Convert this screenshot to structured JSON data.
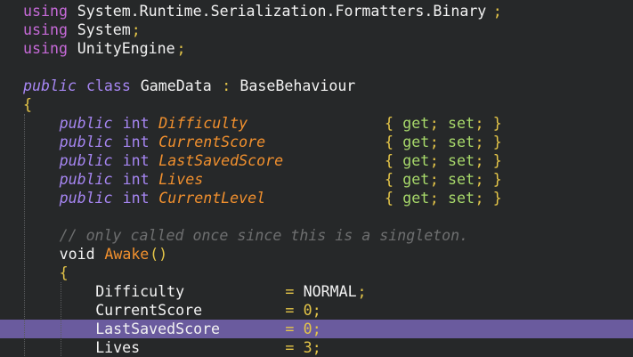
{
  "editor": {
    "lines": [
      {
        "segments": [
          {
            "t": "using",
            "k": "kw-using"
          },
          {
            "t": " System.Runtime.Serialization.Formatters.Binary",
            "k": "plain"
          },
          {
            "t": ";",
            "k": "punct"
          }
        ]
      },
      {
        "segments": [
          {
            "t": "using",
            "k": "kw-using"
          },
          {
            "t": " System",
            "k": "plain"
          },
          {
            "t": ";",
            "k": "punct"
          }
        ]
      },
      {
        "segments": [
          {
            "t": "using",
            "k": "kw-using"
          },
          {
            "t": " UnityEngine",
            "k": "plain"
          },
          {
            "t": ";",
            "k": "punct"
          }
        ]
      },
      {
        "segments": []
      },
      {
        "segments": [
          {
            "t": "public",
            "k": "kw-public"
          },
          {
            "t": " class",
            "k": "kw-class"
          },
          {
            "t": " GameData ",
            "k": "plain"
          },
          {
            "t": ":",
            "k": "op"
          },
          {
            "t": " BaseBehaviour",
            "k": "plain"
          }
        ]
      },
      {
        "segments": [
          {
            "t": "{",
            "k": "punct"
          }
        ]
      },
      {
        "segments": [
          {
            "t": "public",
            "k": "kw-public",
            "c": 4
          },
          {
            "t": "int",
            "k": "type-int",
            "c": 11
          },
          {
            "t": "Difficulty",
            "k": "prop",
            "c": 15
          },
          {
            "t": "{",
            "k": "punct",
            "c": 40
          },
          {
            "t": "get",
            "k": "acc",
            "c": 42
          },
          {
            "t": ";",
            "k": "punct",
            "c": 45
          },
          {
            "t": "set",
            "k": "acc",
            "c": 47
          },
          {
            "t": ";",
            "k": "punct",
            "c": 50
          },
          {
            "t": "}",
            "k": "punct",
            "c": 52
          }
        ]
      },
      {
        "segments": [
          {
            "t": "public",
            "k": "kw-public",
            "c": 4
          },
          {
            "t": "int",
            "k": "type-int",
            "c": 11
          },
          {
            "t": "CurrentScore",
            "k": "prop",
            "c": 15
          },
          {
            "t": "{",
            "k": "punct",
            "c": 40
          },
          {
            "t": "get",
            "k": "acc",
            "c": 42
          },
          {
            "t": ";",
            "k": "punct",
            "c": 45
          },
          {
            "t": "set",
            "k": "acc",
            "c": 47
          },
          {
            "t": ";",
            "k": "punct",
            "c": 50
          },
          {
            "t": "}",
            "k": "punct",
            "c": 52
          }
        ]
      },
      {
        "segments": [
          {
            "t": "public",
            "k": "kw-public",
            "c": 4
          },
          {
            "t": "int",
            "k": "type-int",
            "c": 11
          },
          {
            "t": "LastSavedScore",
            "k": "prop",
            "c": 15
          },
          {
            "t": "{",
            "k": "punct",
            "c": 40
          },
          {
            "t": "get",
            "k": "acc",
            "c": 42
          },
          {
            "t": ";",
            "k": "punct",
            "c": 45
          },
          {
            "t": "set",
            "k": "acc",
            "c": 47
          },
          {
            "t": ";",
            "k": "punct",
            "c": 50
          },
          {
            "t": "}",
            "k": "punct",
            "c": 52
          }
        ]
      },
      {
        "segments": [
          {
            "t": "public",
            "k": "kw-public",
            "c": 4
          },
          {
            "t": "int",
            "k": "type-int",
            "c": 11
          },
          {
            "t": "Lives",
            "k": "prop",
            "c": 15
          },
          {
            "t": "{",
            "k": "punct",
            "c": 40
          },
          {
            "t": "get",
            "k": "acc",
            "c": 42
          },
          {
            "t": ";",
            "k": "punct",
            "c": 45
          },
          {
            "t": "set",
            "k": "acc",
            "c": 47
          },
          {
            "t": ";",
            "k": "punct",
            "c": 50
          },
          {
            "t": "}",
            "k": "punct",
            "c": 52
          }
        ]
      },
      {
        "segments": [
          {
            "t": "public",
            "k": "kw-public",
            "c": 4
          },
          {
            "t": "int",
            "k": "type-int",
            "c": 11
          },
          {
            "t": "CurrentLevel",
            "k": "prop",
            "c": 15
          },
          {
            "t": "{",
            "k": "punct",
            "c": 40
          },
          {
            "t": "get",
            "k": "acc",
            "c": 42
          },
          {
            "t": ";",
            "k": "punct",
            "c": 45
          },
          {
            "t": "set",
            "k": "acc",
            "c": 47
          },
          {
            "t": ";",
            "k": "punct",
            "c": 50
          },
          {
            "t": "}",
            "k": "punct",
            "c": 52
          }
        ]
      },
      {
        "segments": []
      },
      {
        "segments": [
          {
            "t": "// only called once since this is a singleton.",
            "k": "comment",
            "c": 4
          }
        ]
      },
      {
        "segments": [
          {
            "t": "void",
            "k": "type-void",
            "c": 4
          },
          {
            "t": "Awake",
            "k": "fn",
            "c": 9
          },
          {
            "t": "()",
            "k": "punct",
            "c": 14
          }
        ]
      },
      {
        "segments": [
          {
            "t": "{",
            "k": "punct",
            "c": 4
          }
        ]
      },
      {
        "segments": [
          {
            "t": "Difficulty",
            "k": "plain",
            "c": 8
          },
          {
            "t": "=",
            "k": "op",
            "c": 29
          },
          {
            "t": "NORMAL",
            "k": "plain",
            "c": 31
          },
          {
            "t": ";",
            "k": "punct",
            "c": 37
          }
        ]
      },
      {
        "segments": [
          {
            "t": "CurrentScore",
            "k": "plain",
            "c": 8
          },
          {
            "t": "=",
            "k": "op",
            "c": 29
          },
          {
            "t": "0",
            "k": "num",
            "c": 31
          },
          {
            "t": ";",
            "k": "punct",
            "c": 32
          }
        ]
      },
      {
        "segments": [
          {
            "t": "LastSavedScore",
            "k": "plain",
            "c": 8
          },
          {
            "t": "=",
            "k": "op",
            "c": 29
          },
          {
            "t": "0",
            "k": "num",
            "c": 31
          },
          {
            "t": ";",
            "k": "punct",
            "c": 32
          }
        ],
        "highlight": true
      },
      {
        "segments": [
          {
            "t": "Lives",
            "k": "plain",
            "c": 8
          },
          {
            "t": "=",
            "k": "op",
            "c": 29
          },
          {
            "t": "3",
            "k": "num",
            "c": 31
          },
          {
            "t": ";",
            "k": "punct",
            "c": 32
          }
        ]
      }
    ]
  },
  "colors": {
    "background": "#262829",
    "keyword": "#a686f2",
    "using": "#c66ad8",
    "property": "#f1902e",
    "punctuation": "#e4c548",
    "accessor": "#a7d86a",
    "comment": "#6e6f70",
    "highlight": "#6a5b9e"
  }
}
